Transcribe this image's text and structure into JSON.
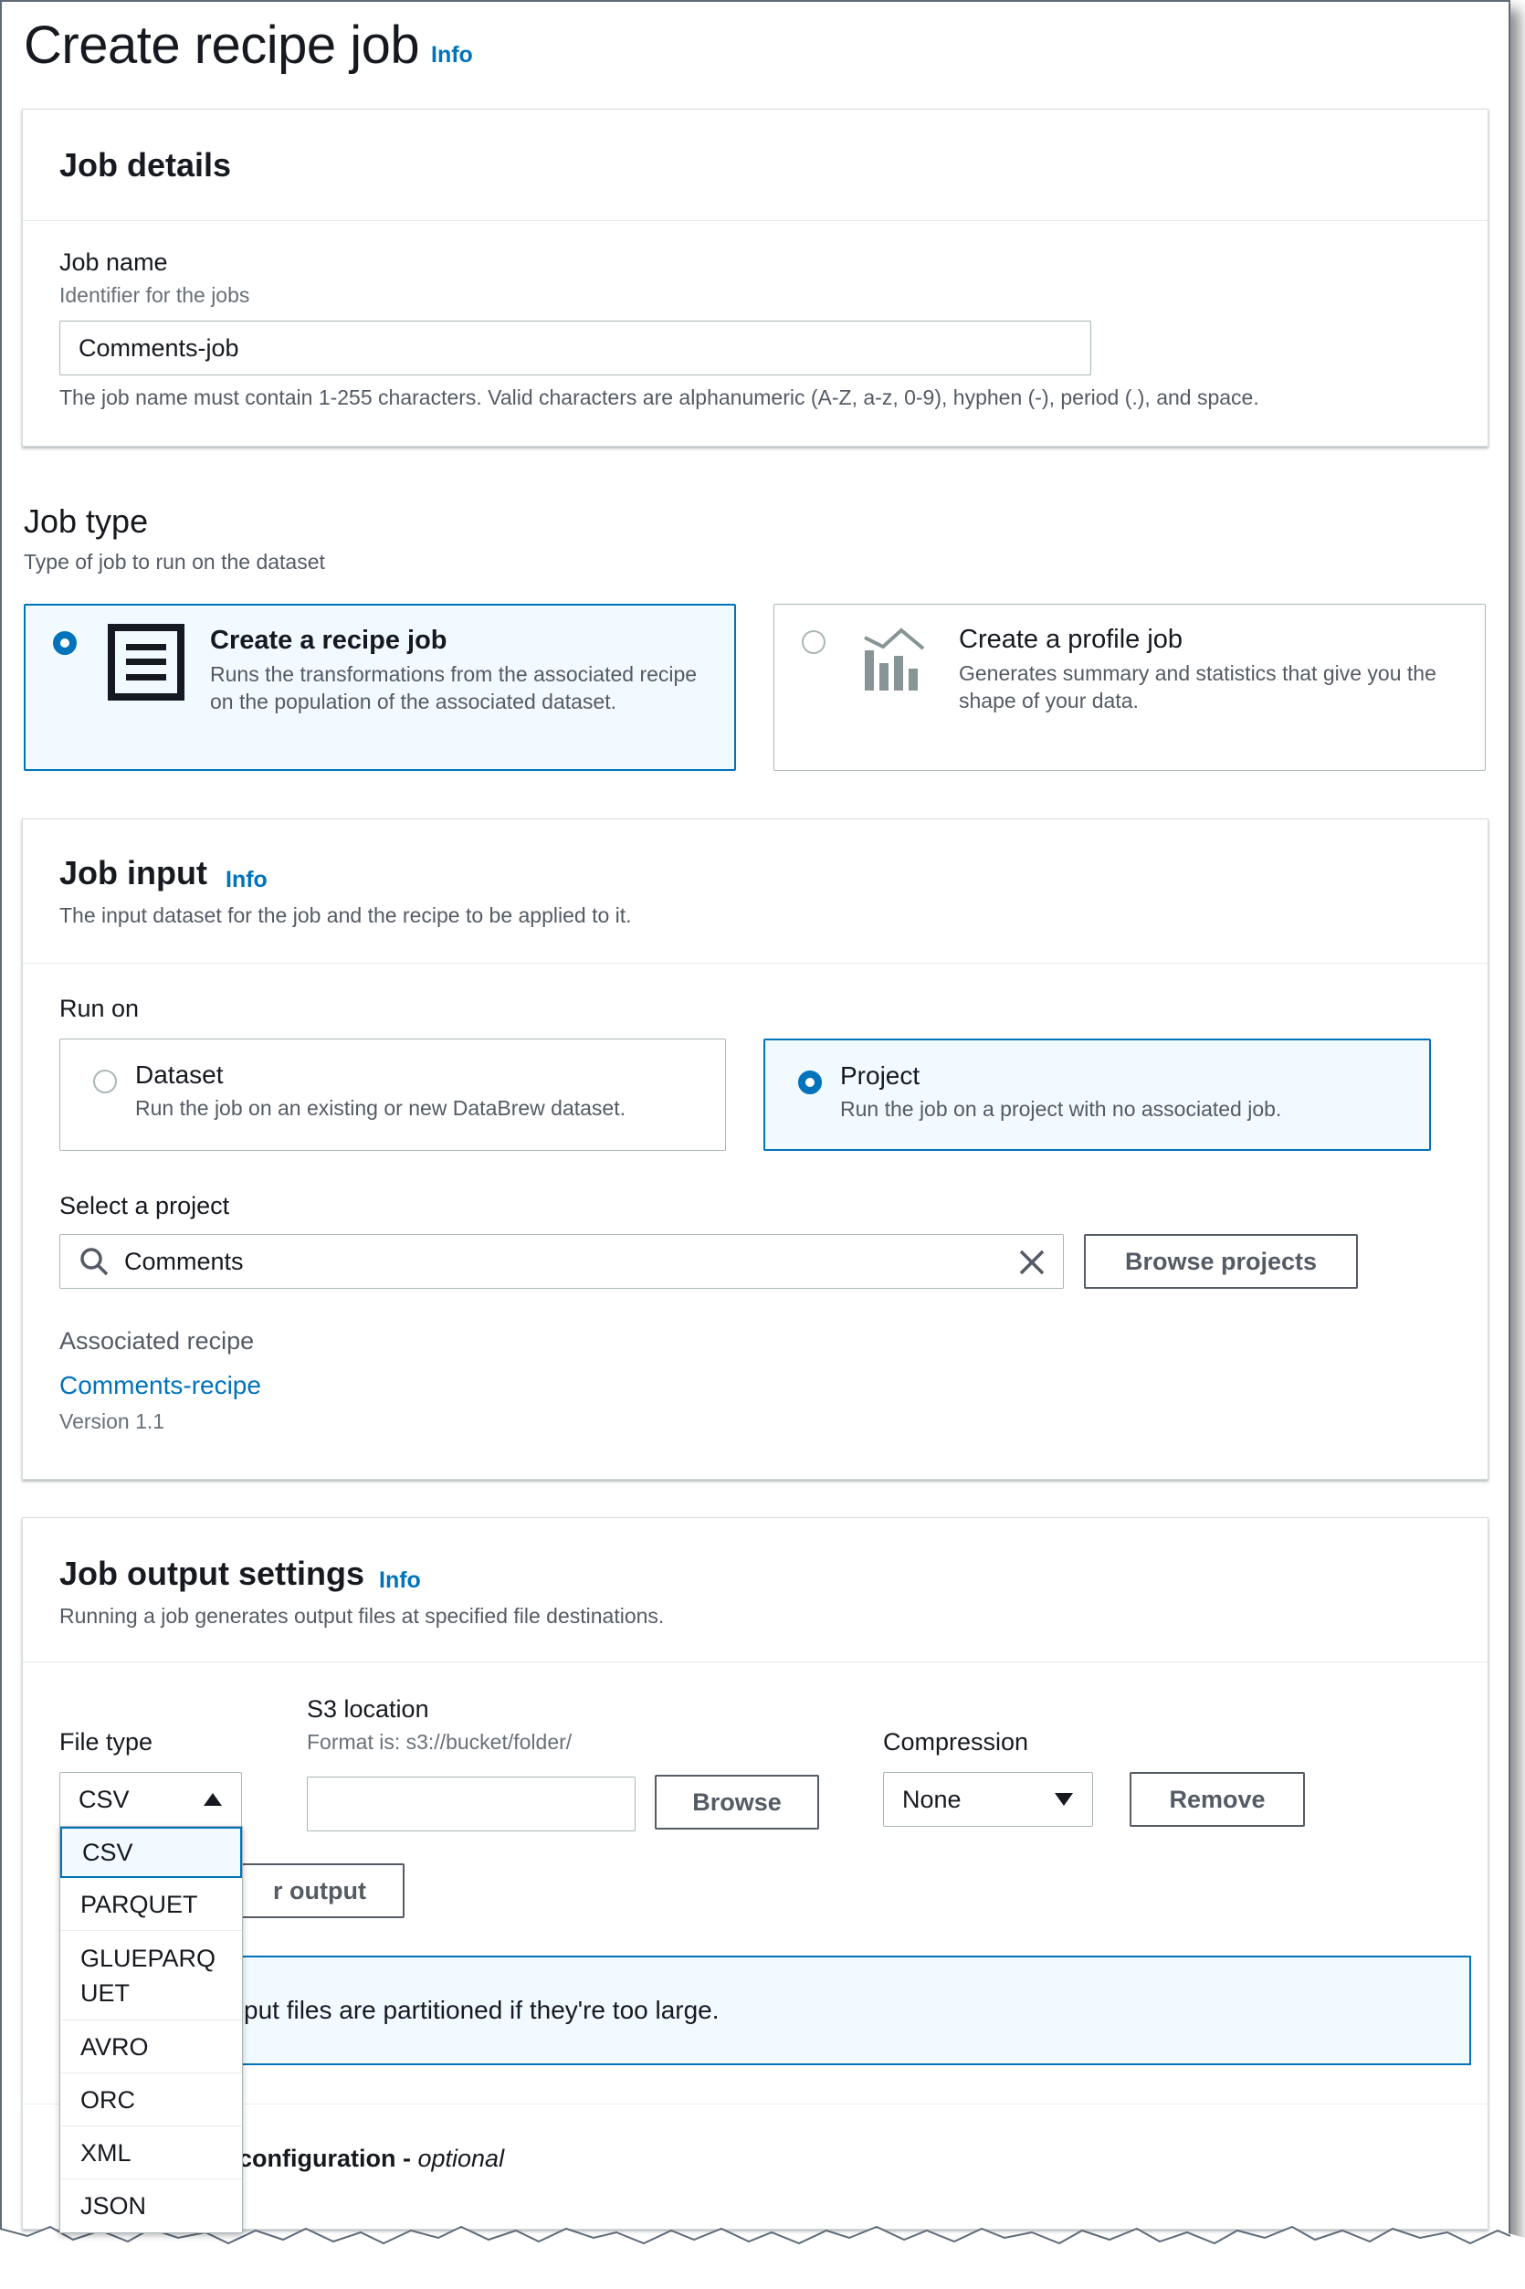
{
  "page": {
    "title": "Create recipe job",
    "info_label": "Info"
  },
  "job_details": {
    "heading": "Job details",
    "name_label": "Job name",
    "name_description": "Identifier for the jobs",
    "name_value": "Comments-job",
    "name_constraint": "The job name must contain 1-255 characters. Valid characters are alphanumeric (A-Z, a-z, 0-9), hyphen (-), period (.), and space."
  },
  "job_type": {
    "heading": "Job type",
    "description": "Type of job to run on the dataset",
    "options": [
      {
        "title": "Create a recipe job",
        "description": "Runs the transformations from the associated recipe on the population of the associated dataset.",
        "selected": true,
        "icon": "recipe-document-icon"
      },
      {
        "title": "Create a profile job",
        "description": "Generates summary and statistics that give you the shape of your data.",
        "selected": false,
        "icon": "bar-chart-icon"
      }
    ]
  },
  "job_input": {
    "heading": "Job input",
    "info_label": "Info",
    "description": "The input dataset for the job and the recipe to be applied to it.",
    "run_on_label": "Run on",
    "run_on_options": [
      {
        "title": "Dataset",
        "description": "Run the job on an existing or new DataBrew dataset.",
        "selected": false
      },
      {
        "title": "Project",
        "description": "Run the job on a project with no associated job.",
        "selected": true
      }
    ],
    "select_project_label": "Select a project",
    "project_value": "Comments",
    "browse_projects_label": "Browse projects",
    "associated_recipe_label": "Associated recipe",
    "recipe_link": "Comments-recipe",
    "recipe_version": "Version 1.1"
  },
  "job_output": {
    "heading": "Job output settings",
    "info_label": "Info",
    "description": "Running a job generates output files at specified file destinations.",
    "file_type_label": "File type",
    "file_type_value": "CSV",
    "s3_label": "S3 location",
    "s3_format": "Format is: s3://bucket/folder/",
    "s3_value": "",
    "browse_label": "Browse",
    "compression_label": "Compression",
    "compression_value": "None",
    "remove_label": "Remove",
    "add_output_partial": "r output",
    "partition_note_partial": "put files are partitioned if they're too large.",
    "config_partial": "configuration",
    "config_optional": "optional",
    "config_separator": " - ",
    "file_type_options": [
      "CSV",
      "PARQUET",
      "GLUEPARQUET",
      "AVRO",
      "ORC",
      "XML",
      "JSON"
    ]
  },
  "colors": {
    "accent": "#0073bb",
    "selected_bg": "#f1faff",
    "text": "#16191f",
    "muted": "#545b64"
  }
}
